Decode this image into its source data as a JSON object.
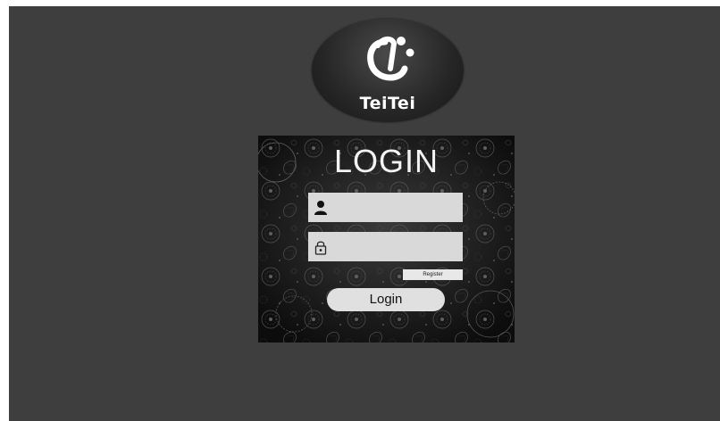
{
  "app": {
    "logo_text": "TeiTei",
    "logo_icon": "teitei-logo-icon"
  },
  "login": {
    "title": "LOGIN",
    "username": {
      "icon": "user-icon",
      "value": "",
      "placeholder": ""
    },
    "password": {
      "icon": "lock-icon",
      "value": "",
      "placeholder": ""
    },
    "register_label": "Register",
    "login_label": "Login"
  },
  "colors": {
    "background": "#3e3e3e",
    "panel": "#1a1a1a",
    "field": "#d9d9d9",
    "button": "#e0e0e0",
    "text_light": "#f2f2f2"
  }
}
